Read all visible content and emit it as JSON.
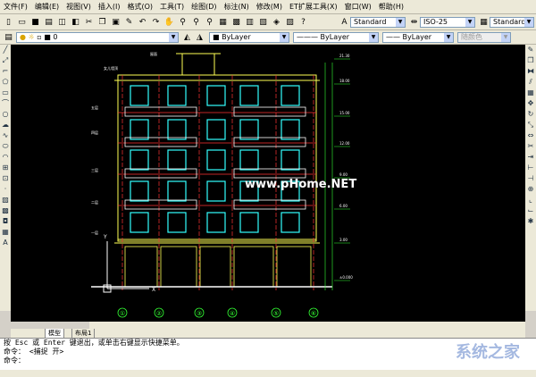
{
  "menu": [
    "文件(F)",
    "编辑(E)",
    "视图(V)",
    "插入(I)",
    "格式(O)",
    "工具(T)",
    "绘图(D)",
    "标注(N)",
    "修改(M)",
    "ET扩展工具(X)",
    "窗口(W)",
    "帮助(H)"
  ],
  "toolbar1": {
    "text_style": "Standard",
    "dim_style": "ISO-25",
    "table_style": "Standard"
  },
  "toolbar2": {
    "layer": "0",
    "color": "ByLayer",
    "linetype": "ByLayer",
    "lineweight": "ByLayer",
    "plotstyle": "随颜色"
  },
  "drawing": {
    "roof_label": "女儿墙顶",
    "roof_label2": "屋面",
    "floor_labels": [
      "五层",
      "四层",
      "三层",
      "二层",
      "一层"
    ],
    "watermark_center": "www.pHome.NET",
    "axis_labels": [
      "①",
      "②",
      "③",
      "④",
      "⑤",
      "⑥"
    ],
    "elev_labels": [
      "21.30",
      "18.00",
      "15.00",
      "12.00",
      "9.00",
      "6.00",
      "3.00",
      "±0.000"
    ]
  },
  "tabs": [
    "模型",
    "布局1"
  ],
  "command": {
    "line1": "按 Esc 或 Enter 键退出，或单击右键显示快捷菜单。",
    "line2": "命令： <捕捉 开>",
    "line3": "命令："
  },
  "brand_watermark": "系统之家"
}
